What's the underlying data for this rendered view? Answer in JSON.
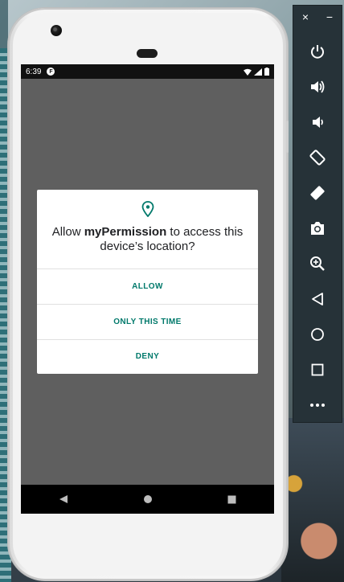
{
  "status_bar": {
    "time": "6:39",
    "app_icon_letter": "F"
  },
  "dialog": {
    "title_prefix": "Allow ",
    "app_name": "myPermission",
    "title_suffix": " to access this device’s location?",
    "buttons": {
      "allow": "ALLOW",
      "only_this_time": "ONLY THIS TIME",
      "deny": "DENY"
    },
    "accent_color": "#00796b"
  },
  "navigation": {
    "back": "back-icon",
    "home": "home-icon",
    "overview": "overview-icon"
  },
  "emulator_toolbar": {
    "close_glyph": "×",
    "minimize_glyph": "−",
    "controls": [
      "power-icon",
      "volume-up-icon",
      "volume-down-icon",
      "rotate-left-icon",
      "rotate-right-icon",
      "camera-icon",
      "zoom-icon",
      "back-icon",
      "home-icon",
      "overview-icon",
      "more-icon"
    ]
  }
}
